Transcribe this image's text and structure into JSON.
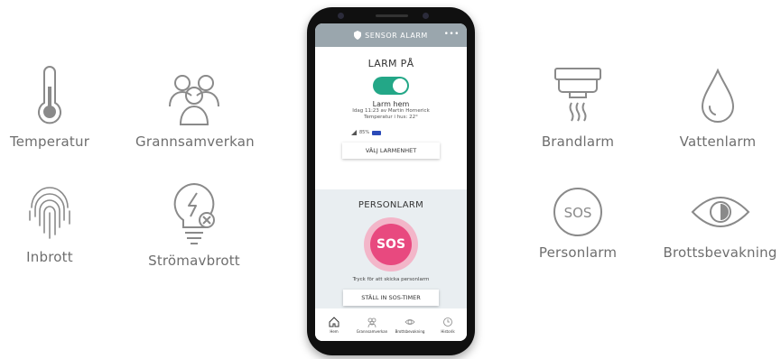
{
  "features": {
    "temperatur": "Temperatur",
    "grannsamverkan": "Grannsamverkan",
    "inbrott": "Inbrott",
    "stromavbrott": "Strömavbrott",
    "brandlarm": "Brandlarm",
    "vattenlarm": "Vattenlarm",
    "personlarm": "Personlarm",
    "brottsbevakning": "Brottsbevakning"
  },
  "app": {
    "title": "SENSOR ALARM",
    "menu_glyph": "•••",
    "alarm": {
      "title": "LARM PÅ",
      "toggle_on": true,
      "status": "Larm hem",
      "detail": "Idag 11:23 av Martin Hornerick",
      "temperature": "Temperatur i hus: 22°",
      "battery_label": "85%",
      "battery_level": 0.85,
      "select_button": "VÄLJ LARMENHET"
    },
    "person": {
      "title": "PERSONLARM",
      "sos_label": "SOS",
      "hint": "Tryck för att skicka personlarm",
      "timer_button": "STÄLL IN SOS-TIMER"
    },
    "nav": {
      "hem": "Hem",
      "grannsamverkan": "Grannsamverkan",
      "brottsbevakning": "Brottsbevakning",
      "historik": "Historik"
    }
  },
  "colors": {
    "accent_green": "#23a787",
    "sos_pink": "#e8497f",
    "header_gray": "#9aa6ad",
    "icon_gray": "#8a8a8a"
  }
}
